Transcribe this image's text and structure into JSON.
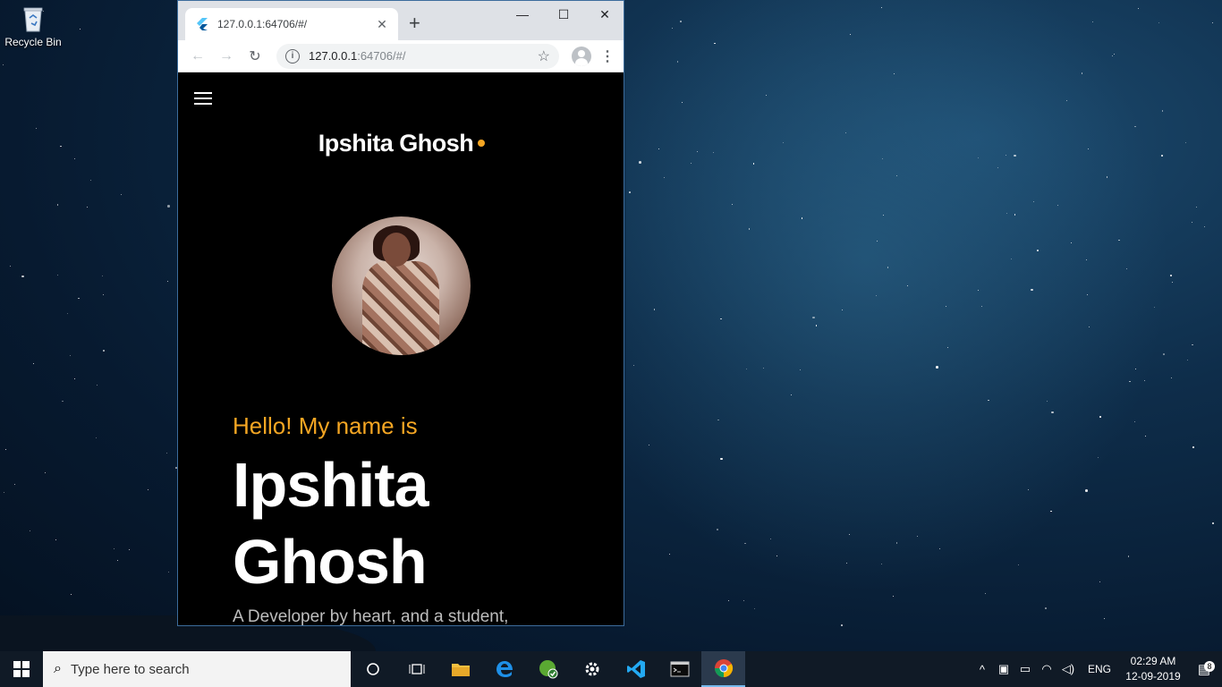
{
  "desktop": {
    "recycle_bin_label": "Recycle Bin"
  },
  "browser": {
    "tab_title": "127.0.0.1:64706/#/",
    "url_host": "127.0.0.1",
    "url_rest": ":64706/#/",
    "new_tab_symbol": "+"
  },
  "page": {
    "brand": "Ipshita Ghosh",
    "greeting": "Hello! My name is",
    "first_name": "Ipshita",
    "last_name": "Ghosh",
    "tagline": "A Developer by heart, and a student,",
    "accent_color": "#f5a623"
  },
  "taskbar": {
    "search_placeholder": "Type here to search",
    "language": "ENG",
    "time": "02:29 AM",
    "date": "12-09-2019",
    "notification_count": "8",
    "pinned": [
      "task-view",
      "file-explorer",
      "edge",
      "green-app",
      "settings",
      "vscode",
      "terminal",
      "chrome"
    ]
  }
}
